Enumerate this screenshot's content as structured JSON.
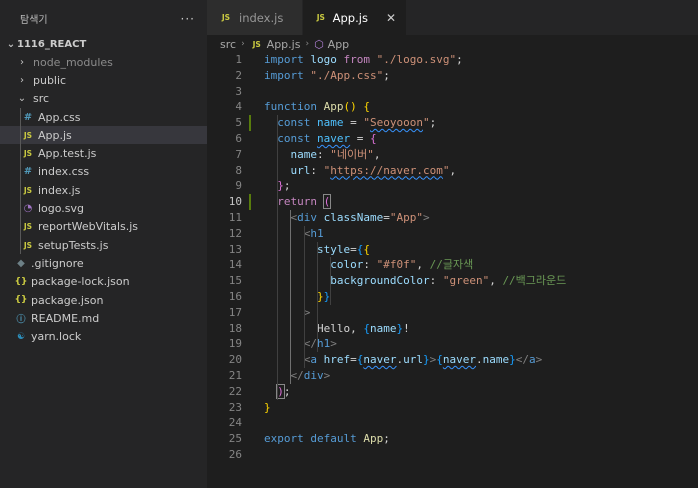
{
  "sidebar": {
    "title": "탐색기",
    "more": "···",
    "root": "1116_REACT",
    "items": [
      {
        "label": "node_modules",
        "kind": "folder",
        "open": false,
        "depth": 1,
        "dim": true
      },
      {
        "label": "public",
        "kind": "folder",
        "open": false,
        "depth": 1
      },
      {
        "label": "src",
        "kind": "folder",
        "open": true,
        "depth": 1
      },
      {
        "label": "App.css",
        "kind": "css",
        "depth": 2
      },
      {
        "label": "App.js",
        "kind": "js",
        "depth": 2,
        "selected": true
      },
      {
        "label": "App.test.js",
        "kind": "js",
        "depth": 2
      },
      {
        "label": "index.css",
        "kind": "css",
        "depth": 2
      },
      {
        "label": "index.js",
        "kind": "js",
        "depth": 2
      },
      {
        "label": "logo.svg",
        "kind": "svg",
        "depth": 2
      },
      {
        "label": "reportWebVitals.js",
        "kind": "js",
        "depth": 2
      },
      {
        "label": "setupTests.js",
        "kind": "js",
        "depth": 2
      },
      {
        "label": ".gitignore",
        "kind": "git",
        "depth": 1
      },
      {
        "label": "package-lock.json",
        "kind": "json",
        "depth": 1
      },
      {
        "label": "package.json",
        "kind": "json",
        "depth": 1
      },
      {
        "label": "README.md",
        "kind": "info",
        "depth": 1
      },
      {
        "label": "yarn.lock",
        "kind": "yarn",
        "depth": 1
      }
    ]
  },
  "tabs": [
    {
      "label": "index.js",
      "icon": "JS",
      "active": false
    },
    {
      "label": "App.js",
      "icon": "JS",
      "active": true,
      "close": "✕"
    }
  ],
  "breadcrumb": {
    "folder": "src",
    "file": "App.js",
    "file_icon": "JS",
    "symbol": "App",
    "sep": "›"
  },
  "editor": {
    "current_line": 10,
    "lines": [
      {
        "n": "1",
        "tokens": [
          [
            "kw",
            "import"
          ],
          [
            "txt",
            " "
          ],
          [
            "var",
            "logo"
          ],
          [
            "txt",
            " "
          ],
          [
            "ctrl",
            "from"
          ],
          [
            "txt",
            " "
          ],
          [
            "str",
            "\"./logo.svg\""
          ],
          [
            "txt",
            ";"
          ]
        ]
      },
      {
        "n": "2",
        "tokens": [
          [
            "kw",
            "import"
          ],
          [
            "txt",
            " "
          ],
          [
            "str",
            "\"./App.css\""
          ],
          [
            "txt",
            ";"
          ]
        ]
      },
      {
        "n": "3",
        "tokens": []
      },
      {
        "n": "4",
        "tokens": [
          [
            "kw",
            "function"
          ],
          [
            "txt",
            " "
          ],
          [
            "fn",
            "App"
          ],
          [
            "p1",
            "()"
          ],
          [
            "txt",
            " "
          ],
          [
            "p1",
            "{"
          ]
        ]
      },
      {
        "n": "5",
        "tokens": [
          [
            "txt",
            "  "
          ],
          [
            "kw",
            "const"
          ],
          [
            "txt",
            " "
          ],
          [
            "const",
            "name"
          ],
          [
            "txt",
            " = "
          ],
          [
            "str",
            "\""
          ],
          [
            "str squig",
            "Seoyooon"
          ],
          [
            "str",
            "\""
          ],
          [
            "txt",
            ";"
          ]
        ]
      },
      {
        "n": "6",
        "tokens": [
          [
            "txt",
            "  "
          ],
          [
            "kw",
            "const"
          ],
          [
            "txt",
            " "
          ],
          [
            "const squig",
            "naver"
          ],
          [
            "txt",
            " = "
          ],
          [
            "p2",
            "{"
          ]
        ]
      },
      {
        "n": "7",
        "tokens": [
          [
            "txt",
            "    "
          ],
          [
            "var",
            "name"
          ],
          [
            "txt",
            ": "
          ],
          [
            "str",
            "\"네이버\""
          ],
          [
            "txt",
            ","
          ]
        ]
      },
      {
        "n": "8",
        "tokens": [
          [
            "txt",
            "    "
          ],
          [
            "var",
            "url"
          ],
          [
            "txt",
            ": "
          ],
          [
            "str",
            "\""
          ],
          [
            "str squig",
            "https://naver.com"
          ],
          [
            "str",
            "\""
          ],
          [
            "txt",
            ","
          ]
        ]
      },
      {
        "n": "9",
        "tokens": [
          [
            "txt",
            "  "
          ],
          [
            "p2",
            "}"
          ],
          [
            "txt",
            ";"
          ]
        ]
      },
      {
        "n": "10",
        "tokens": [
          [
            "txt",
            "  "
          ],
          [
            "ctrl",
            "return"
          ],
          [
            "txt",
            " "
          ],
          [
            "p2 bmatch",
            "("
          ]
        ]
      },
      {
        "n": "11",
        "tokens": [
          [
            "txt",
            "    "
          ],
          [
            "brk",
            "<"
          ],
          [
            "tag",
            "div"
          ],
          [
            "txt",
            " "
          ],
          [
            "attr",
            "className"
          ],
          [
            "txt",
            "="
          ],
          [
            "str",
            "\"App\""
          ],
          [
            "brk",
            ">"
          ]
        ]
      },
      {
        "n": "12",
        "tokens": [
          [
            "txt",
            "      "
          ],
          [
            "brk",
            "<"
          ],
          [
            "tag",
            "h1"
          ]
        ]
      },
      {
        "n": "13",
        "tokens": [
          [
            "txt",
            "        "
          ],
          [
            "attr",
            "style"
          ],
          [
            "txt",
            "="
          ],
          [
            "p3",
            "{"
          ],
          [
            "p1",
            "{"
          ]
        ]
      },
      {
        "n": "14",
        "tokens": [
          [
            "txt",
            "          "
          ],
          [
            "var",
            "color"
          ],
          [
            "txt",
            ": "
          ],
          [
            "str",
            "\"#f0f\""
          ],
          [
            "txt",
            ", "
          ],
          [
            "cmt",
            "//글자색"
          ]
        ]
      },
      {
        "n": "15",
        "tokens": [
          [
            "txt",
            "          "
          ],
          [
            "var",
            "backgroundColor"
          ],
          [
            "txt",
            ": "
          ],
          [
            "str",
            "\"green\""
          ],
          [
            "txt",
            ", "
          ],
          [
            "cmt",
            "//백그라운드"
          ]
        ]
      },
      {
        "n": "16",
        "tokens": [
          [
            "txt",
            "        "
          ],
          [
            "p1",
            "}"
          ],
          [
            "p3",
            "}"
          ]
        ]
      },
      {
        "n": "17",
        "tokens": [
          [
            "txt",
            "      "
          ],
          [
            "brk",
            ">"
          ]
        ]
      },
      {
        "n": "18",
        "tokens": [
          [
            "txt",
            "        Hello, "
          ],
          [
            "p3",
            "{"
          ],
          [
            "var",
            "name"
          ],
          [
            "p3",
            "}"
          ],
          [
            "txt",
            "!"
          ]
        ]
      },
      {
        "n": "19",
        "tokens": [
          [
            "txt",
            "      "
          ],
          [
            "brk",
            "</"
          ],
          [
            "tag",
            "h1"
          ],
          [
            "brk",
            ">"
          ]
        ]
      },
      {
        "n": "20",
        "tokens": [
          [
            "txt",
            "      "
          ],
          [
            "brk",
            "<"
          ],
          [
            "tag",
            "a"
          ],
          [
            "txt",
            " "
          ],
          [
            "attr",
            "href"
          ],
          [
            "txt",
            "="
          ],
          [
            "p3",
            "{"
          ],
          [
            "var squig",
            "naver"
          ],
          [
            "txt",
            "."
          ],
          [
            "var",
            "url"
          ],
          [
            "p3",
            "}"
          ],
          [
            "brk",
            ">"
          ],
          [
            "p3",
            "{"
          ],
          [
            "var squig",
            "naver"
          ],
          [
            "txt",
            "."
          ],
          [
            "var",
            "name"
          ],
          [
            "p3",
            "}"
          ],
          [
            "brk",
            "</"
          ],
          [
            "tag",
            "a"
          ],
          [
            "brk",
            ">"
          ]
        ]
      },
      {
        "n": "21",
        "tokens": [
          [
            "txt",
            "    "
          ],
          [
            "brk",
            "</"
          ],
          [
            "tag",
            "div"
          ],
          [
            "brk",
            ">"
          ]
        ]
      },
      {
        "n": "22",
        "tokens": [
          [
            "txt",
            "  "
          ],
          [
            "p2 bmatch",
            ")"
          ],
          [
            "txt",
            ";"
          ]
        ]
      },
      {
        "n": "23",
        "tokens": [
          [
            "p1",
            "}"
          ]
        ]
      },
      {
        "n": "24",
        "tokens": []
      },
      {
        "n": "25",
        "tokens": [
          [
            "kw",
            "export"
          ],
          [
            "txt",
            " "
          ],
          [
            "kw",
            "default"
          ],
          [
            "txt",
            " "
          ],
          [
            "fn",
            "App"
          ],
          [
            "txt",
            ";"
          ]
        ]
      },
      {
        "n": "26",
        "tokens": []
      }
    ]
  }
}
